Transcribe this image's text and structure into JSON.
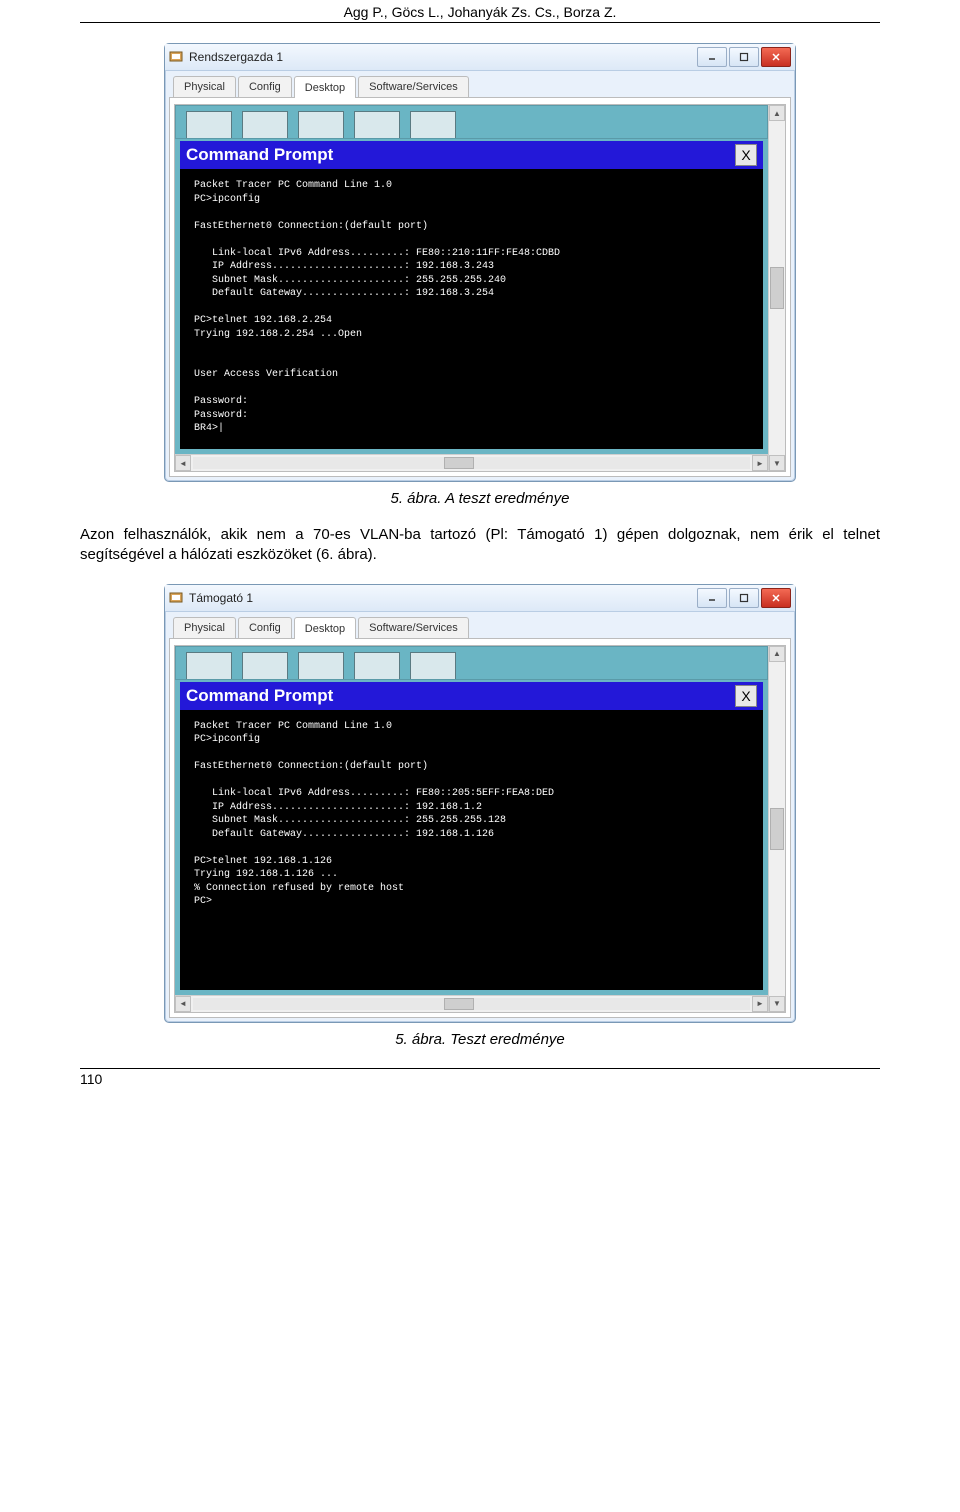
{
  "header_authors": "Agg P., Göcs L., Johanyák Zs. Cs., Borza Z.",
  "screenshot1": {
    "window_title": "Rendszergazda 1",
    "tabs": [
      "Physical",
      "Config",
      "Desktop",
      "Software/Services"
    ],
    "active_tab_index": 2,
    "cmd_title": "Command Prompt",
    "cmd_close_label": "X",
    "terminal_lines": [
      "Packet Tracer PC Command Line 1.0",
      "PC>ipconfig",
      "",
      "FastEthernet0 Connection:(default port)",
      "",
      "   Link-local IPv6 Address.........: FE80::210:11FF:FE48:CDBD",
      "   IP Address......................: 192.168.3.243",
      "   Subnet Mask.....................: 255.255.255.240",
      "   Default Gateway.................: 192.168.3.254",
      "",
      "PC>telnet 192.168.2.254",
      "Trying 192.168.2.254 ...Open",
      "",
      "",
      "User Access Verification",
      "",
      "Password:",
      "Password:",
      "BR4>|"
    ]
  },
  "caption1": "5. ábra. A teszt eredménye",
  "paragraph": "Azon felhasználók, akik nem a 70-es VLAN-ba tartozó (Pl: Támogató 1) gépen dolgoznak, nem érik el telnet segítségével a hálózati eszközöket (6. ábra).",
  "screenshot2": {
    "window_title": "Támogató 1",
    "tabs": [
      "Physical",
      "Config",
      "Desktop",
      "Software/Services"
    ],
    "active_tab_index": 2,
    "cmd_title": "Command Prompt",
    "cmd_close_label": "X",
    "terminal_lines": [
      "Packet Tracer PC Command Line 1.0",
      "PC>ipconfig",
      "",
      "FastEthernet0 Connection:(default port)",
      "",
      "   Link-local IPv6 Address.........: FE80::205:5EFF:FEA8:DED",
      "   IP Address......................: 192.168.1.2",
      "   Subnet Mask.....................: 255.255.255.128",
      "   Default Gateway.................: 192.168.1.126",
      "",
      "PC>telnet 192.168.1.126",
      "Trying 192.168.1.126 ...",
      "% Connection refused by remote host",
      "PC>"
    ]
  },
  "caption2": "5.  ábra. Teszt eredménye",
  "page_number": "110"
}
